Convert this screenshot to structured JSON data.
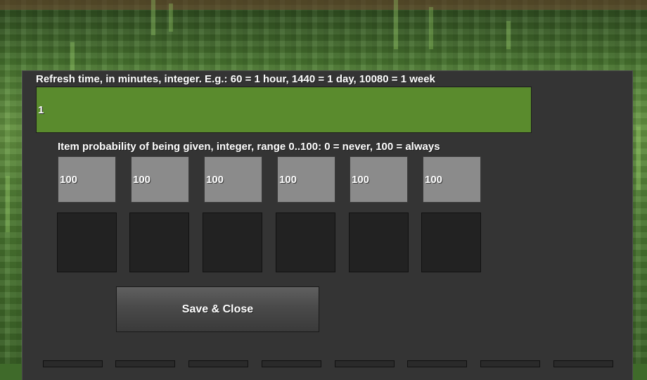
{
  "refresh": {
    "label": "Refresh time, in minutes, integer. E.g.: 60 = 1 hour, 1440 = 1 day, 10080 = 1 week",
    "value": "1"
  },
  "probability": {
    "label": "Item probability of being given, integer, range 0..100: 0 = never, 100 = always",
    "values": [
      "100",
      "100",
      "100",
      "100",
      "100",
      "100"
    ]
  },
  "save_button": {
    "label": "Save & Close"
  },
  "colors": {
    "panel": "#343434",
    "refresh_field": "#5a8b2d",
    "probability_field": "#8b8b8b",
    "item_slot": "#222222"
  }
}
